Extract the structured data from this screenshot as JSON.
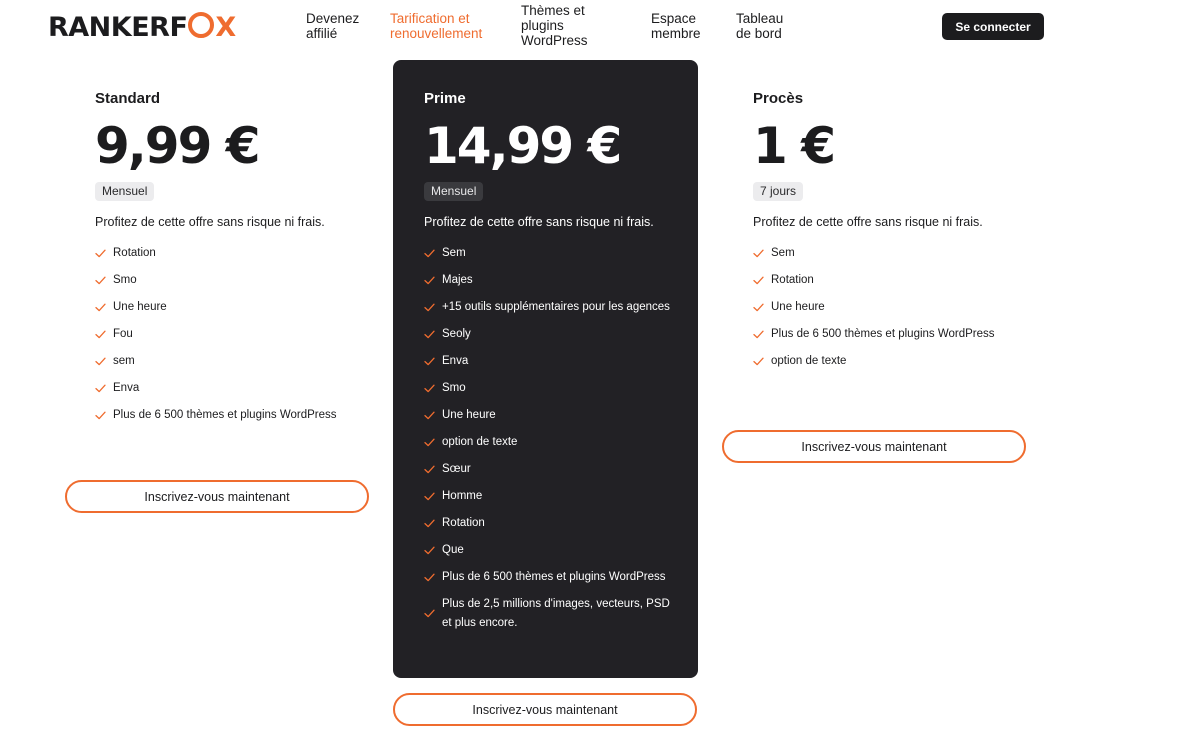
{
  "brand": {
    "logo_part1": "RANKERF",
    "logo_part2": "X",
    "accent_color": "#ef6c2f",
    "dark_color": "#222125"
  },
  "nav": {
    "items": [
      {
        "label": "Devenez\naffilié"
      },
      {
        "label": "Tarification et\nrenouvellement",
        "active": true
      },
      {
        "label": "Thèmes et\nplugins\nWordPress"
      },
      {
        "label": "Espace\nmembre"
      },
      {
        "label": "Tableau\nde bord"
      }
    ],
    "login_label": "Se connecter"
  },
  "plans": [
    {
      "name": "Standard",
      "price": "9,99 €",
      "period": "Mensuel",
      "description": "Profitez de cette offre sans risque ni frais.",
      "features": [
        "Rotation",
        "Smo",
        "Une heure",
        "Fou",
        "sem",
        "Enva",
        "Plus de 6 500 thèmes et plugins WordPress"
      ],
      "cta": "Inscrivez-vous maintenant"
    },
    {
      "name": "Prime",
      "price": "14,99 €",
      "period": "Mensuel",
      "description": "Profitez de cette offre sans risque ni frais.",
      "features": [
        "Sem",
        "Majes",
        "+15 outils supplémentaires pour les agences",
        "Seoly",
        "Enva",
        "Smo",
        "Une heure",
        "option de texte",
        "Sœur",
        "Homme",
        "Rotation",
        "Que",
        "Plus de 6 500 thèmes et plugins WordPress",
        "Plus de 2,5 millions d'images, vecteurs, PSD et plus encore."
      ],
      "cta": "Inscrivez-vous maintenant"
    },
    {
      "name": "Procès",
      "price": "1 €",
      "period": "7 jours",
      "description": "Profitez de cette offre sans risque ni frais.",
      "features": [
        "Sem",
        "Rotation",
        "Une heure",
        "Plus de 6 500 thèmes et plugins WordPress",
        "option de texte"
      ],
      "cta": "Inscrivez-vous maintenant"
    }
  ],
  "icons": {
    "check": "check-icon"
  }
}
